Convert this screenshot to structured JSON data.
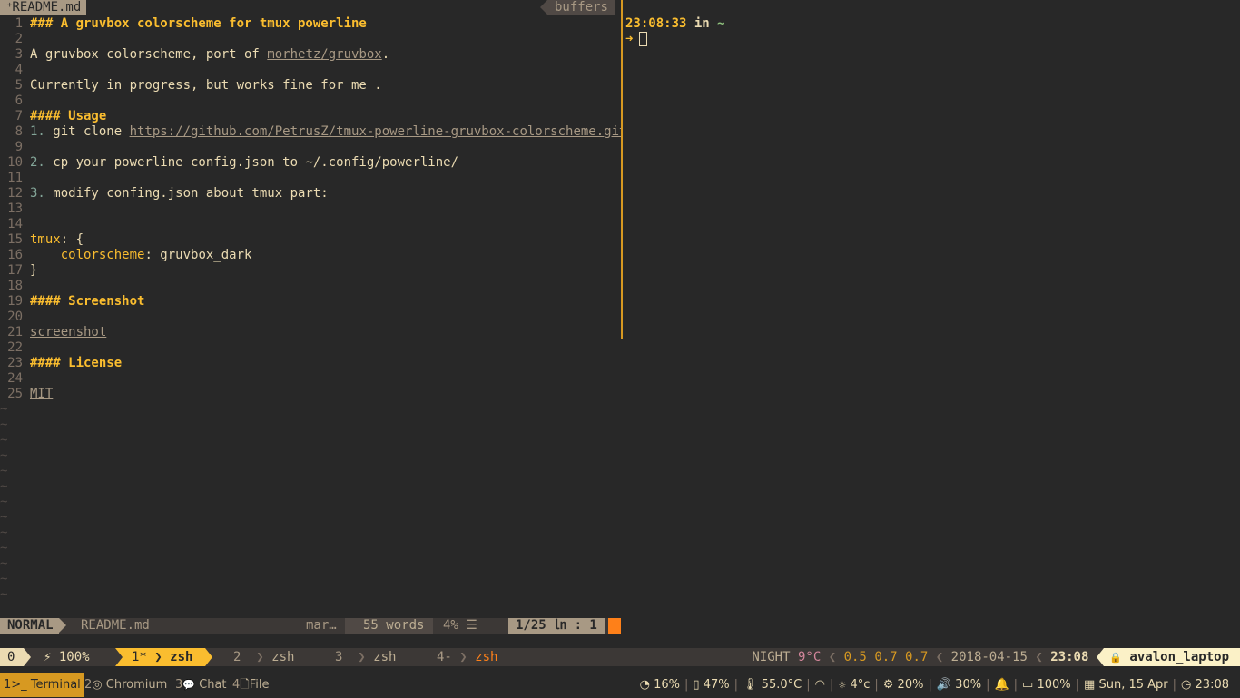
{
  "vim": {
    "tab_mod": "+",
    "tab_name": "README.md",
    "buffers_label": "buffers",
    "lines": [
      {
        "n": "1",
        "parts": [
          {
            "t": "### A gruvbox colorscheme for tmux powerline",
            "c": "h"
          }
        ]
      },
      {
        "n": "2",
        "parts": []
      },
      {
        "n": "3",
        "parts": [
          {
            "t": "A gruvbox colorscheme, port of ",
            "c": ""
          },
          {
            "t": "morhetz/gruvbox",
            "c": "lnk"
          },
          {
            "t": ".",
            "c": ""
          }
        ]
      },
      {
        "n": "4",
        "parts": []
      },
      {
        "n": "5",
        "parts": [
          {
            "t": "Currently in progress, but works fine for me .",
            "c": ""
          }
        ]
      },
      {
        "n": "6",
        "parts": []
      },
      {
        "n": "7",
        "parts": [
          {
            "t": "#### Usage",
            "c": "h"
          }
        ]
      },
      {
        "n": "8",
        "parts": [
          {
            "t": "1.",
            "c": "num"
          },
          {
            "t": " git clone ",
            "c": ""
          },
          {
            "t": "https://github.com/PetrusZ/tmux-powerline-gruvbox-colorscheme.git",
            "c": "lnk"
          },
          {
            "t": " ~/",
            "c": ""
          }
        ]
      },
      {
        "n": "9",
        "parts": []
      },
      {
        "n": "10",
        "parts": [
          {
            "t": "2.",
            "c": "num"
          },
          {
            "t": " cp your powerline config.json to ~/.config/powerline/",
            "c": ""
          }
        ]
      },
      {
        "n": "11",
        "parts": []
      },
      {
        "n": "12",
        "parts": [
          {
            "t": "3.",
            "c": "num"
          },
          {
            "t": " modify confing.json about tmux part:",
            "c": ""
          }
        ]
      },
      {
        "n": "13",
        "parts": []
      },
      {
        "n": "14",
        "parts": []
      },
      {
        "n": "15",
        "parts": [
          {
            "t": "tmux",
            "c": "key"
          },
          {
            "t": ": {",
            "c": ""
          }
        ]
      },
      {
        "n": "16",
        "parts": [
          {
            "t": "    ",
            "c": ""
          },
          {
            "t": "colorscheme",
            "c": "key"
          },
          {
            "t": ": gruvbox_dark",
            "c": ""
          }
        ]
      },
      {
        "n": "17",
        "parts": [
          {
            "t": "}",
            "c": ""
          }
        ]
      },
      {
        "n": "18",
        "parts": []
      },
      {
        "n": "19",
        "parts": [
          {
            "t": "#### Screenshot",
            "c": "h"
          }
        ]
      },
      {
        "n": "20",
        "parts": []
      },
      {
        "n": "21",
        "parts": [
          {
            "t": "screenshot",
            "c": "lnk"
          }
        ]
      },
      {
        "n": "22",
        "parts": []
      },
      {
        "n": "23",
        "parts": [
          {
            "t": "#### License",
            "c": "h"
          }
        ]
      },
      {
        "n": "24",
        "parts": []
      },
      {
        "n": "25",
        "parts": [
          {
            "t": "MIT",
            "c": "lnk"
          }
        ]
      }
    ],
    "tilde": "~",
    "tilde_count": 13,
    "status": {
      "mode": "NORMAL",
      "file": "README.md",
      "filetype": "mar…",
      "words": "55 words",
      "percent": "4% ☰",
      "position": "1/25 ㏑ :  1"
    }
  },
  "shell": {
    "time": "23:08:33",
    "in": " in ",
    "cwd": "~",
    "arrow": "➜"
  },
  "tmux": {
    "session": "0",
    "battery_icon": "⚡",
    "battery": "100%",
    "windows": [
      {
        "index": "1*",
        "name": "zsh",
        "active": true
      },
      {
        "index": "2",
        "name": "zsh",
        "active": false
      },
      {
        "index": "3",
        "name": "zsh",
        "active": false
      },
      {
        "index": "4-",
        "name": "zsh",
        "active": false
      }
    ],
    "right": {
      "night": "NIGHT",
      "temp": "9°C",
      "load1": "0.5",
      "load5": "0.7",
      "load15": "0.7",
      "date": "2018-04-15",
      "clock": "23:08",
      "lock_icon": "🔒",
      "host": "avalon_laptop"
    }
  },
  "sysbar": {
    "workspaces": [
      {
        "num": "1",
        "icon": ">_",
        "label": "Terminal",
        "active": true
      },
      {
        "num": "2",
        "icon": "◎",
        "label": "Chromium",
        "active": false
      },
      {
        "num": "3",
        "icon": "💬",
        "label": "Chat",
        "active": false
      },
      {
        "num": "4",
        "icon": "🗋",
        "label": "File",
        "active": false
      }
    ],
    "cpu": "16%",
    "mem": "47%",
    "cpu_temp": "55.0°C",
    "weather": "4°c",
    "brightness": "20%",
    "volume": "30%",
    "battery": "100%",
    "date": "Sun, 15 Apr",
    "time": "23:08"
  }
}
